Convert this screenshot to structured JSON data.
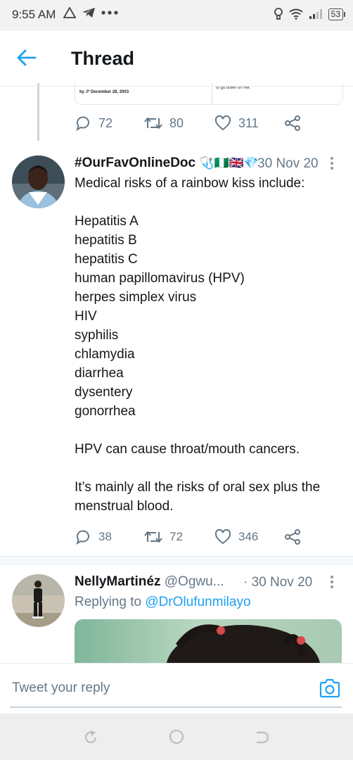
{
  "status_bar": {
    "time": "9:55 AM",
    "battery": "53"
  },
  "app_bar": {
    "title": "Thread"
  },
  "embedded_card": {
    "left_text": "by J* December 28, 2003",
    "right_text": "to go down on her."
  },
  "tweet1": {
    "replies": "72",
    "retweets": "80",
    "likes": "311"
  },
  "tweet2": {
    "handle": "#OurFavOnlineDoc",
    "handle_emojis": "🩺🇳🇬🇬🇧💎",
    "date": "30 Nov 20",
    "text": "Medical risks of a rainbow kiss include:\n\nHepatitis A\nhepatitis B\nhepatitis C\nhuman papillomavirus (HPV)\nherpes simplex virus\nHIV\nsyphilis\nchlamydia\ndiarrhea\ndysentery\ngonorrhea\n\nHPV can cause throat/mouth cancers.\n\nIt’s mainly all the risks of oral sex plus the menstrual blood.",
    "replies": "38",
    "retweets": "72",
    "likes": "346"
  },
  "tweet3": {
    "name": "NellyMartinéz",
    "username": "@Ogwu...",
    "date": "· 30 Nov 20",
    "replying_prefix": "Replying to",
    "replying_to": "@DrOlufunmilayo"
  },
  "reply_bar": {
    "placeholder": "Tweet your reply"
  },
  "colors": {
    "accent": "#1da1f2",
    "muted": "#657786",
    "text": "#14171a"
  }
}
